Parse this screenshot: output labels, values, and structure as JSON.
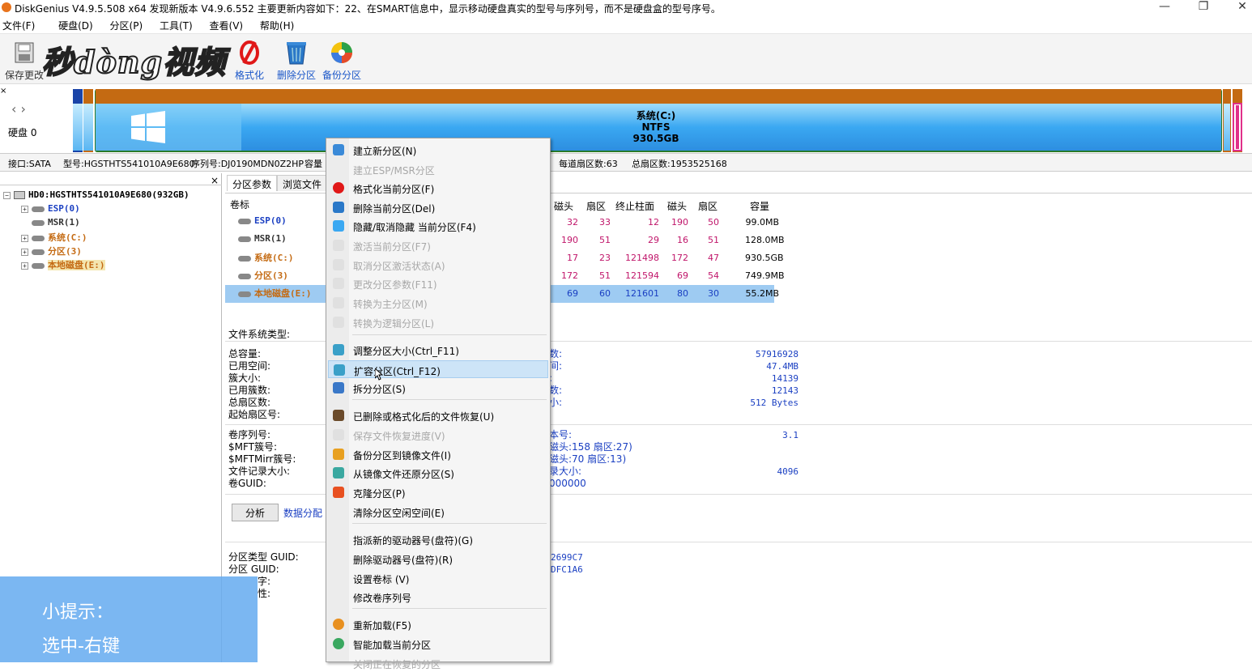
{
  "window": {
    "title": "DiskGenius V4.9.5.508 x64   发现新版本 V4.9.6.552 主要更新内容如下：22、在SMART信息中，显示移动硬盘真实的型号与序列号，而不是硬盘盒的型号序号。",
    "minimize": "—",
    "maximize": "❐",
    "close": "✕"
  },
  "menubar": [
    "文件(F)",
    "硬盘(D)",
    "分区(P)",
    "工具(T)",
    "查看(V)",
    "帮助(H)"
  ],
  "toolbar": {
    "save": "保存更改",
    "format": "格式化",
    "delete": "删除分区",
    "backup": "备份分区"
  },
  "watermark": {
    "logo": "秒dòng视频"
  },
  "disk_nav": {
    "label": "硬盘 0"
  },
  "diskmap": {
    "label_name": "系统(C:)",
    "label_fs": "NTFS",
    "label_size": "930.5GB"
  },
  "infobar": {
    "interface": "接口:SATA",
    "model": "型号:HGSTHTS541010A9E680",
    "serial": "序列号:DJ0190MDN0Z2HP",
    "capacity": "容量",
    "sectors_per_track": "每道扇区数:63",
    "total_sectors": "总扇区数:1953525168"
  },
  "tree": {
    "disk": "HD0:HGSTHTS541010A9E680(932GB)",
    "partitions": [
      "ESP(0)",
      "MSR(1)",
      "系统(C:)",
      "分区(3)",
      "本地磁盘(E:)"
    ]
  },
  "tabs": [
    "分区参数",
    "浏览文件"
  ],
  "vol_header": "卷标",
  "columns": [
    "磁头",
    "扇区",
    "终止柱面",
    "磁头",
    "扇区",
    "容量"
  ],
  "rows": [
    {
      "label": "ESP(0)",
      "c": [
        "32",
        "33",
        "12",
        "190",
        "50",
        "99.0MB"
      ]
    },
    {
      "label": "MSR(1)",
      "c": [
        "190",
        "51",
        "29",
        "16",
        "51",
        "128.0MB"
      ]
    },
    {
      "label": "系统(C:)",
      "c": [
        "17",
        "23",
        "121498",
        "172",
        "47",
        "930.5GB"
      ]
    },
    {
      "label": "分区(3)",
      "c": [
        "172",
        "51",
        "121594",
        "69",
        "54",
        "749.9MB"
      ]
    },
    {
      "label": "本地磁盘(E:)",
      "c": [
        "69",
        "60",
        "121601",
        "80",
        "30",
        "55.2MB"
      ]
    }
  ],
  "fs_type_label": "文件系统类型:",
  "left_labels": [
    "总容量:",
    "已用空间:",
    "簇大小:",
    "已用簇数:",
    "总扇区数:",
    "起始扇区号:"
  ],
  "left_labels2": [
    "卷序列号:",
    "$MFT簇号:",
    "$MFTMirr簇号:",
    "文件记录大小:",
    "卷GUID:"
  ],
  "mid_labels": [
    "数:",
    "间:",
    ":",
    "数:",
    "小:"
  ],
  "mid_labels2": [
    "本号:",
    "磁头:158 扇区:27)",
    "磁头:70 扇区:13)",
    "录大小:",
    "000000"
  ],
  "right_values": [
    "57916928",
    "47.4MB",
    "14139",
    "12143",
    "512 Bytes"
  ],
  "right_values2": [
    "3.1",
    "",
    "",
    "4096"
  ],
  "analyze_btn": "分析",
  "data_dist": "数据分配",
  "guid_labels": [
    "分区类型 GUID:",
    "分区 GUID:",
    "字:",
    "性:"
  ],
  "guid_values": [
    "2699C7",
    "DFC1A6"
  ],
  "context_menu": [
    {
      "label": "建立新分区(N)",
      "disabled": false
    },
    {
      "label": "建立ESP/MSR分区",
      "disabled": true
    },
    {
      "label": "格式化当前分区(F)",
      "disabled": false
    },
    {
      "label": "删除当前分区(Del)",
      "disabled": false
    },
    {
      "label": "隐藏/取消隐藏 当前分区(F4)",
      "disabled": false
    },
    {
      "label": "激活当前分区(F7)",
      "disabled": true
    },
    {
      "label": "取消分区激活状态(A)",
      "disabled": true
    },
    {
      "label": "更改分区参数(F11)",
      "disabled": true
    },
    {
      "label": "转换为主分区(M)",
      "disabled": true
    },
    {
      "label": "转换为逻辑分区(L)",
      "disabled": true
    },
    {
      "label": "调整分区大小(Ctrl_F11)",
      "disabled": false
    },
    {
      "label": "扩容分区(Ctrl_F12)",
      "disabled": false
    },
    {
      "label": "拆分分区(S)",
      "disabled": false
    },
    {
      "label": "已删除或格式化后的文件恢复(U)",
      "disabled": false
    },
    {
      "label": "保存文件恢复进度(V)",
      "disabled": true
    },
    {
      "label": "备份分区到镜像文件(I)",
      "disabled": false
    },
    {
      "label": "从镜像文件还原分区(S)",
      "disabled": false
    },
    {
      "label": "克隆分区(P)",
      "disabled": false
    },
    {
      "label": "清除分区空闲空间(E)",
      "disabled": false
    },
    {
      "label": "指派新的驱动器号(盘符)(G)",
      "disabled": false
    },
    {
      "label": "删除驱动器号(盘符)(R)",
      "disabled": false
    },
    {
      "label": "设置卷标 (V)",
      "disabled": false
    },
    {
      "label": "修改卷序列号",
      "disabled": false
    },
    {
      "label": "重新加载(F5)",
      "disabled": false
    },
    {
      "label": "智能加载当前分区",
      "disabled": false
    },
    {
      "label": "关闭正在恢复的分区",
      "disabled": true
    }
  ],
  "tip": {
    "line1": "小提示：",
    "line2": "选中-右键"
  },
  "colors": {
    "accent_blue": "#1a56c8",
    "partition_orange": "#c46a12",
    "partition_blue": "#3aa0f0",
    "highlight_row": "#9ecbf2",
    "tip_bg": "#64aaf0"
  }
}
